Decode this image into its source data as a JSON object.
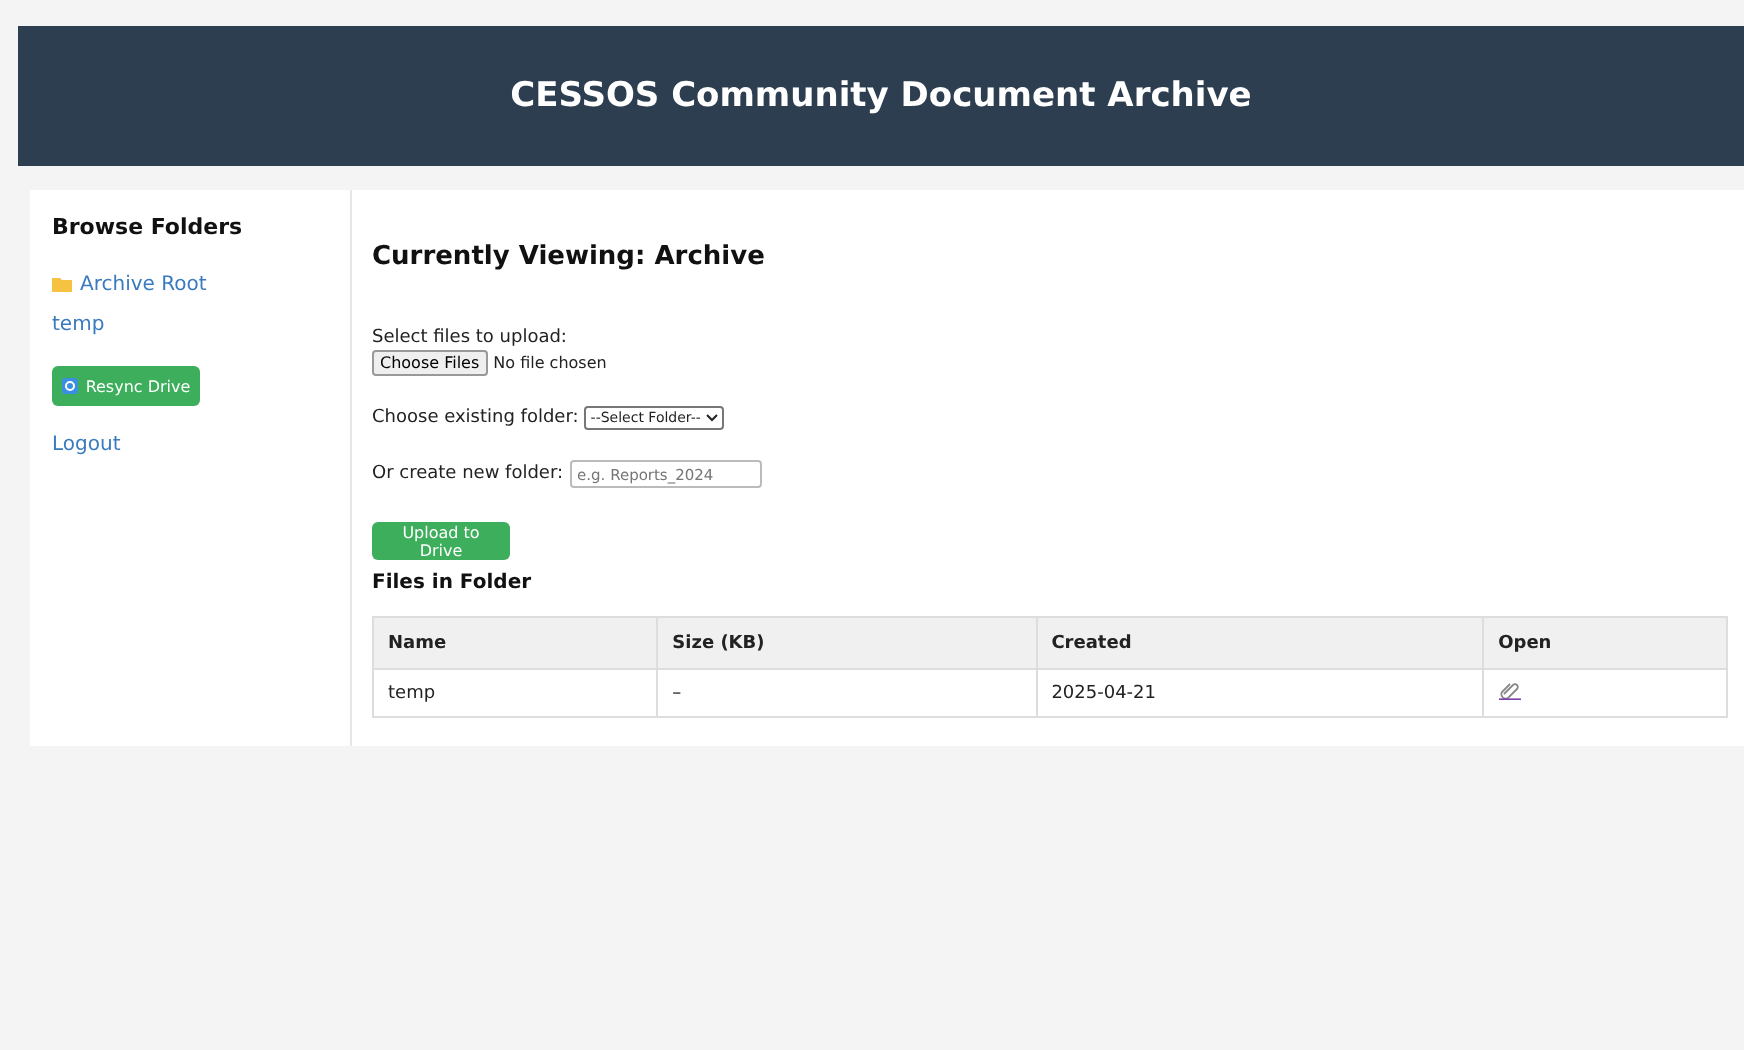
{
  "header": {
    "title": "CESSOS Community Document Archive"
  },
  "sidebar": {
    "heading": "Browse Folders",
    "folders": [
      {
        "label": "Archive Root",
        "kind": "root"
      },
      {
        "label": "temp",
        "kind": "plain"
      }
    ],
    "resync_button": "Resync Drive",
    "logout": "Logout"
  },
  "main": {
    "title": "Currently Viewing: Archive",
    "upload": {
      "label": "Select files to upload:",
      "button": "Choose Files",
      "status": "No file chosen"
    },
    "folder_select": {
      "label": "Choose existing folder:",
      "value": "--Select Folder--"
    },
    "new_folder": {
      "label": "Or create new folder:",
      "placeholder": "e.g. Reports_2024"
    },
    "submit": "Upload to Drive",
    "files_heading": "Files in Folder",
    "table": {
      "columns": [
        "Name",
        "Size (KB)",
        "Created",
        "Open"
      ],
      "rows": [
        {
          "name": "temp",
          "size": "–",
          "created": "2025-04-21"
        }
      ]
    }
  }
}
